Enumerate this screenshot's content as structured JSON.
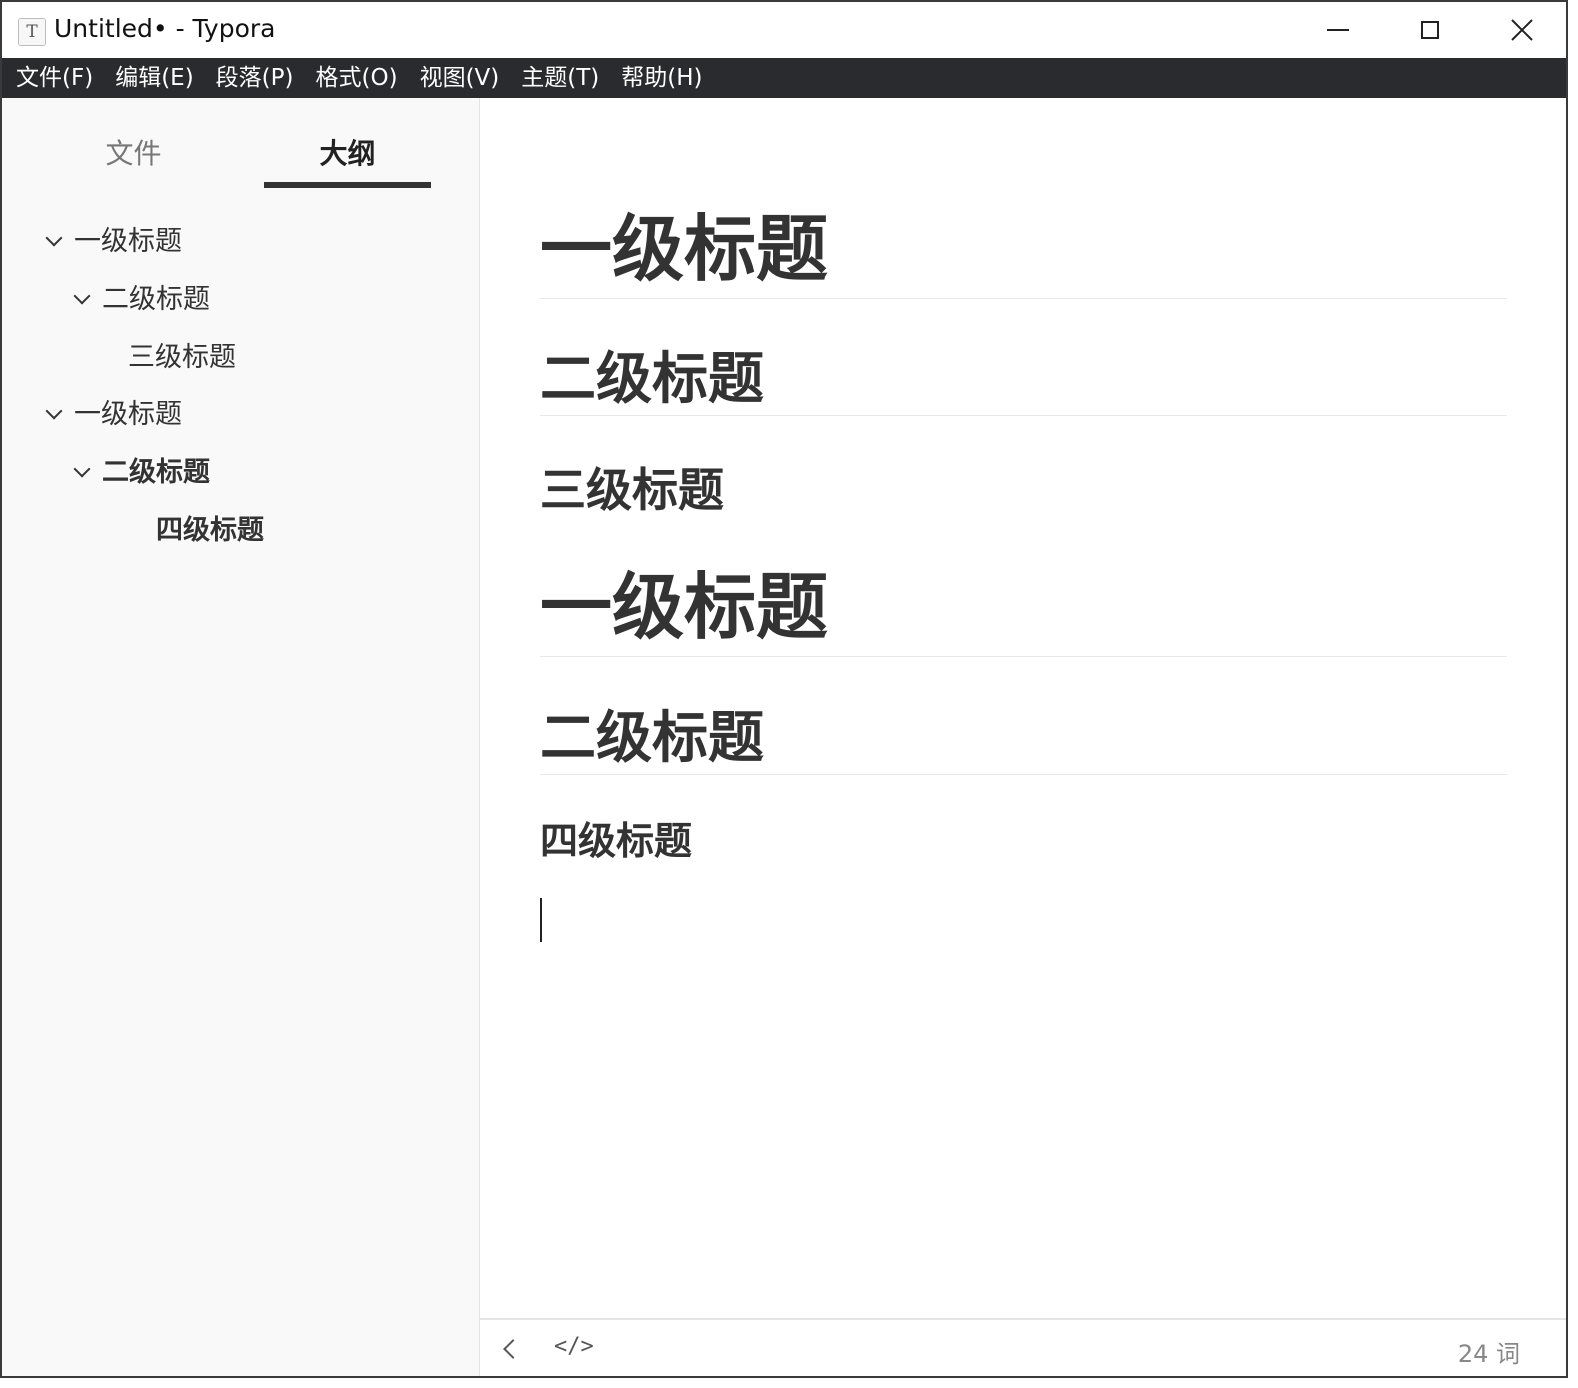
{
  "window": {
    "title": "Untitled• - Typora",
    "app_icon_glyph": "T"
  },
  "menu": [
    {
      "label": "文件(F)"
    },
    {
      "label": "编辑(E)"
    },
    {
      "label": "段落(P)"
    },
    {
      "label": "格式(O)"
    },
    {
      "label": "视图(V)"
    },
    {
      "label": "主题(T)"
    },
    {
      "label": "帮助(H)"
    }
  ],
  "sidebar": {
    "tabs": [
      {
        "label": "文件",
        "active": false
      },
      {
        "label": "大纲",
        "active": true
      }
    ],
    "outline": [
      {
        "label": "一级标题",
        "level": 1,
        "collapsible": true,
        "active": false
      },
      {
        "label": "二级标题",
        "level": 2,
        "collapsible": true,
        "active": false
      },
      {
        "label": "三级标题",
        "level": 3,
        "collapsible": false,
        "active": false
      },
      {
        "label": "一级标题",
        "level": 1,
        "collapsible": true,
        "active": false
      },
      {
        "label": "二级标题",
        "level": 2,
        "collapsible": true,
        "active": true
      },
      {
        "label": "四级标题",
        "level": 4,
        "collapsible": false,
        "active": true
      }
    ]
  },
  "document": {
    "headings": [
      {
        "level": 1,
        "text": "一级标题"
      },
      {
        "level": 2,
        "text": "二级标题"
      },
      {
        "level": 3,
        "text": "三级标题"
      },
      {
        "level": 1,
        "text": "一级标题"
      },
      {
        "level": 2,
        "text": "二级标题"
      },
      {
        "level": 4,
        "text": "四级标题"
      }
    ]
  },
  "statusbar": {
    "source_toggle_glyph": "</>",
    "word_count": "24 词"
  },
  "icons": {
    "minimize": "minimize-icon",
    "maximize": "maximize-icon",
    "close": "close-icon",
    "back": "chevron-left-icon",
    "chevron": "chevron-down-icon"
  }
}
